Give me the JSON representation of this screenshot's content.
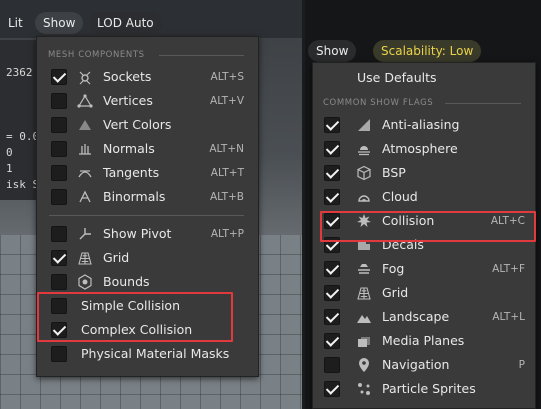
{
  "colors": {
    "highlight": "#e0393e",
    "scalability_text": "#e8d34a"
  },
  "left_viewport": {
    "buttons": {
      "lit": "Lit",
      "show": "Show",
      "lod": "LOD Auto"
    },
    "stats": {
      "s1": "2362",
      "s2": "= 0.0",
      "s3": "0",
      "s4": "1",
      "s5": "isk Si"
    }
  },
  "left_menu": {
    "section_title": "MESH COMPONENTS",
    "group1": [
      {
        "label": "Sockets",
        "shortcut": "ALT+S",
        "checked": true,
        "icon": "sockets-icon"
      },
      {
        "label": "Vertices",
        "shortcut": "ALT+V",
        "checked": false,
        "icon": "vertices-icon"
      },
      {
        "label": "Vert Colors",
        "shortcut": "",
        "checked": false,
        "icon": "vert-colors-icon"
      },
      {
        "label": "Normals",
        "shortcut": "ALT+N",
        "checked": false,
        "icon": "normals-icon"
      },
      {
        "label": "Tangents",
        "shortcut": "ALT+T",
        "checked": false,
        "icon": "tangents-icon"
      },
      {
        "label": "Binormals",
        "shortcut": "ALT+B",
        "checked": false,
        "icon": "binormals-icon"
      }
    ],
    "group2": [
      {
        "label": "Show Pivot",
        "shortcut": "ALT+P",
        "checked": false,
        "icon": "pivot-icon"
      },
      {
        "label": "Grid",
        "shortcut": "",
        "checked": true,
        "icon": "grid-icon"
      },
      {
        "label": "Bounds",
        "shortcut": "",
        "checked": false,
        "icon": "bounds-icon"
      },
      {
        "label": "Simple Collision",
        "shortcut": "",
        "checked": false,
        "icon": ""
      },
      {
        "label": "Complex Collision",
        "shortcut": "",
        "checked": true,
        "icon": ""
      },
      {
        "label": "Physical Material Masks",
        "shortcut": "",
        "checked": false,
        "icon": ""
      }
    ]
  },
  "right_viewport": {
    "show": "Show",
    "scalability": "Scalability: Low"
  },
  "right_menu": {
    "use_defaults": "Use Defaults",
    "section_title": "COMMON SHOW FLAGS",
    "items": [
      {
        "label": "Anti-aliasing",
        "shortcut": "",
        "checked": true,
        "icon": "anti-aliasing-icon"
      },
      {
        "label": "Atmosphere",
        "shortcut": "",
        "checked": true,
        "icon": "atmosphere-icon"
      },
      {
        "label": "BSP",
        "shortcut": "",
        "checked": true,
        "icon": "bsp-icon"
      },
      {
        "label": "Cloud",
        "shortcut": "",
        "checked": true,
        "icon": "cloud-icon"
      },
      {
        "label": "Collision",
        "shortcut": "ALT+C",
        "checked": true,
        "icon": "collision-icon"
      },
      {
        "label": "Decals",
        "shortcut": "",
        "checked": true,
        "icon": "decals-icon"
      },
      {
        "label": "Fog",
        "shortcut": "ALT+F",
        "checked": true,
        "icon": "fog-icon"
      },
      {
        "label": "Grid",
        "shortcut": "",
        "checked": true,
        "icon": "grid-icon"
      },
      {
        "label": "Landscape",
        "shortcut": "ALT+L",
        "checked": true,
        "icon": "landscape-icon"
      },
      {
        "label": "Media Planes",
        "shortcut": "",
        "checked": true,
        "icon": "media-planes-icon"
      },
      {
        "label": "Navigation",
        "shortcut": "P",
        "checked": false,
        "icon": "navigation-icon"
      },
      {
        "label": "Particle Sprites",
        "shortcut": "",
        "checked": true,
        "icon": "particle-sprites-icon"
      }
    ]
  }
}
